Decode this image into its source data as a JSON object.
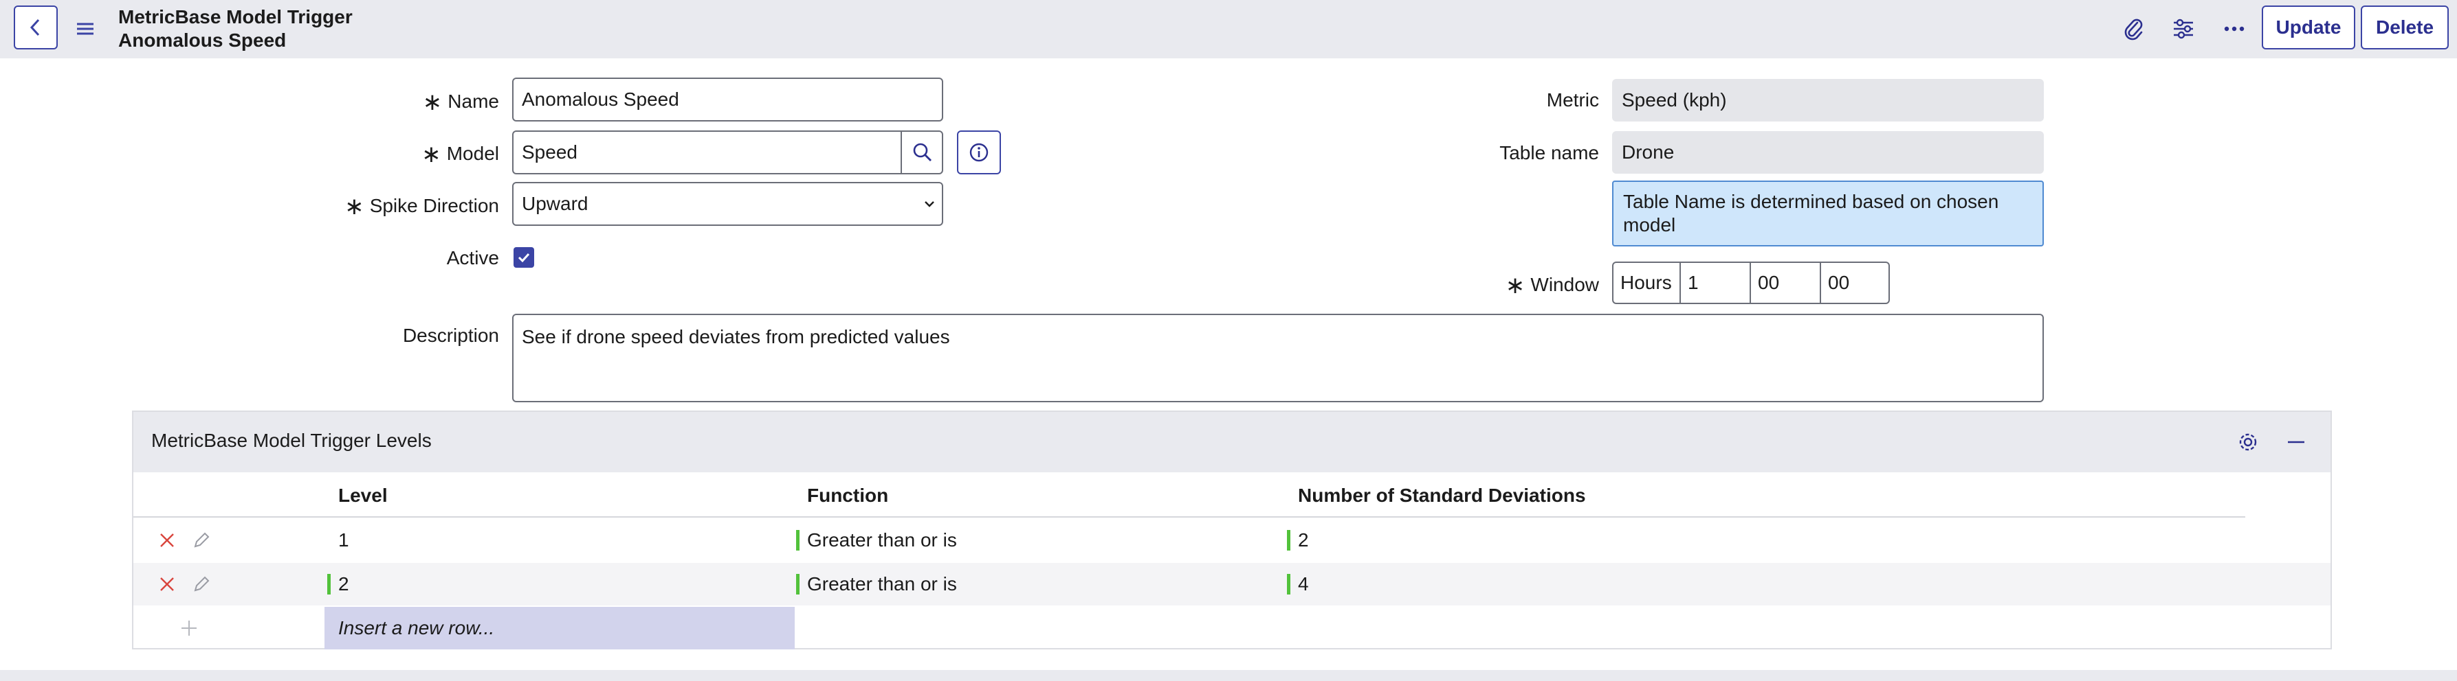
{
  "header": {
    "title_line1": "MetricBase Model Trigger",
    "title_line2": "Anomalous Speed",
    "update_label": "Update",
    "delete_label": "Delete"
  },
  "form": {
    "name": {
      "label": "Name",
      "value": "Anomalous Speed"
    },
    "model": {
      "label": "Model",
      "value": "Speed"
    },
    "spike_direction": {
      "label": "Spike Direction",
      "value": "Upward"
    },
    "active": {
      "label": "Active",
      "checked": true
    },
    "description": {
      "label": "Description",
      "value": "See if drone speed deviates from predicted values"
    },
    "metric": {
      "label": "Metric",
      "value": "Speed (kph)"
    },
    "table_name": {
      "label": "Table name",
      "value": "Drone"
    },
    "table_name_info": "Table Name is determined based on chosen model",
    "window": {
      "label": "Window",
      "unit": "Hours",
      "hours": "1",
      "minutes": "00",
      "seconds": "00"
    },
    "required_marker": "∗"
  },
  "related_list": {
    "title": "MetricBase Model Trigger Levels",
    "columns": [
      "Level",
      "Function",
      "Number of Standard Deviations"
    ],
    "rows": [
      {
        "level": "1",
        "function": "Greater than or is",
        "stddev": "2"
      },
      {
        "level": "2",
        "function": "Greater than or is",
        "stddev": "4"
      }
    ],
    "insert_placeholder": "Insert a new row..."
  },
  "colors": {
    "accent": "#3b44a5",
    "header_bg": "#e9eaef",
    "valid_bar": "#52c23b",
    "info_bg": "#cfe6fb",
    "delete_x": "#d9453d",
    "insert_bg": "#d2d3ec"
  }
}
